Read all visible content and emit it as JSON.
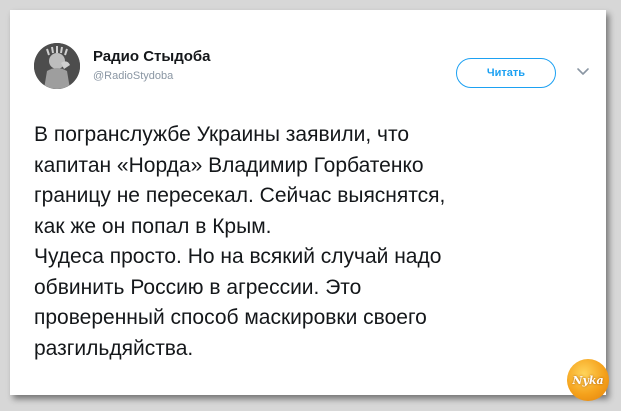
{
  "tweet": {
    "display_name": "Радио Стыдоба",
    "handle": "@RadioStydoba",
    "follow_label": "Читать",
    "avatar_icon": "statue-of-liberty-facepalm-avatar",
    "menu_icon": "chevron-down-icon",
    "text": "В погранслужбе Украины заявили, что\nкапитан «Норда» Владимир Горбатенко\nграницу не пересекал. Сейчас выяснятся,\nкак же он попал в Крым.\nЧудеса просто. Но на всякий случай надо\nобвинить Россию в агрессии. Это\nпроверенный способ маскировки своего\nразгильдяйства."
  },
  "watermark": {
    "text": "Nyka",
    "icon": "nyka-logo"
  },
  "colors": {
    "accent": "#1da1f2",
    "text": "#14171a",
    "muted": "#8a96a3",
    "background": "#d7d7d7",
    "card": "#ffffff",
    "watermark": "#f5a21c"
  }
}
